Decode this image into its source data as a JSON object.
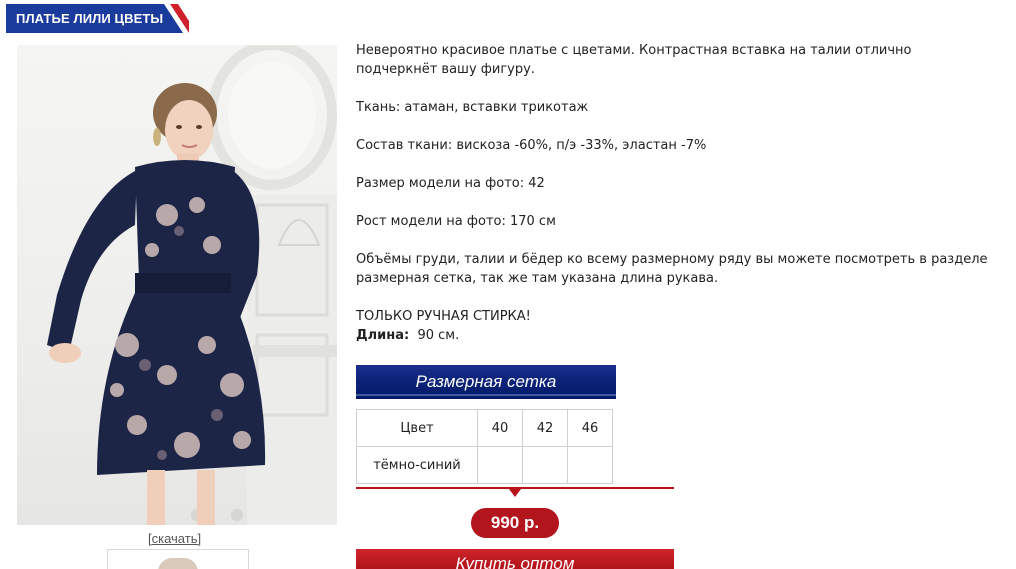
{
  "product": {
    "title": "ПЛАТЬЕ ЛИЛИ ЦВЕТЫ",
    "download_label": "[скачать]"
  },
  "description": {
    "intro": "Невероятно красивое платье с цветами. Контрастная вставка на талии отлично подчеркнёт вашу фигуру.",
    "fabric": "Ткань: атаман, вставки трикотаж",
    "composition": "Состав ткани:  вискоза -60%, п/э -33%, эластан -7%",
    "model_size": "Размер модели на фото: 42",
    "model_height": "Рост модели на фото: 170 см",
    "measurements": "Объёмы груди, талии и бёдер ко всему размерному ряду вы можете посмотреть в разделе размерная сетка, так же там указана длина рукава.",
    "care": "ТОЛЬКО РУЧНАЯ СТИРКА!",
    "length_label": "Длина:",
    "length_value": "90 см."
  },
  "size_chart_button": "Размерная сетка",
  "sizes_table": {
    "color_header": "Цвет",
    "sizes": [
      "40",
      "42",
      "46"
    ],
    "rows": [
      {
        "color": "тёмно-синий",
        "cells": [
          "",
          "",
          ""
        ]
      }
    ]
  },
  "price": "990 р.",
  "buy_button": "Купить оптом",
  "colors": {
    "title_bg": "#1a3a9c",
    "title_accent": "#d0202a",
    "size_button_bg": "#0d237a",
    "price_bg": "#b3151c",
    "buy_button_bg": "#c41c23",
    "dress_navy": "#1c2546"
  }
}
